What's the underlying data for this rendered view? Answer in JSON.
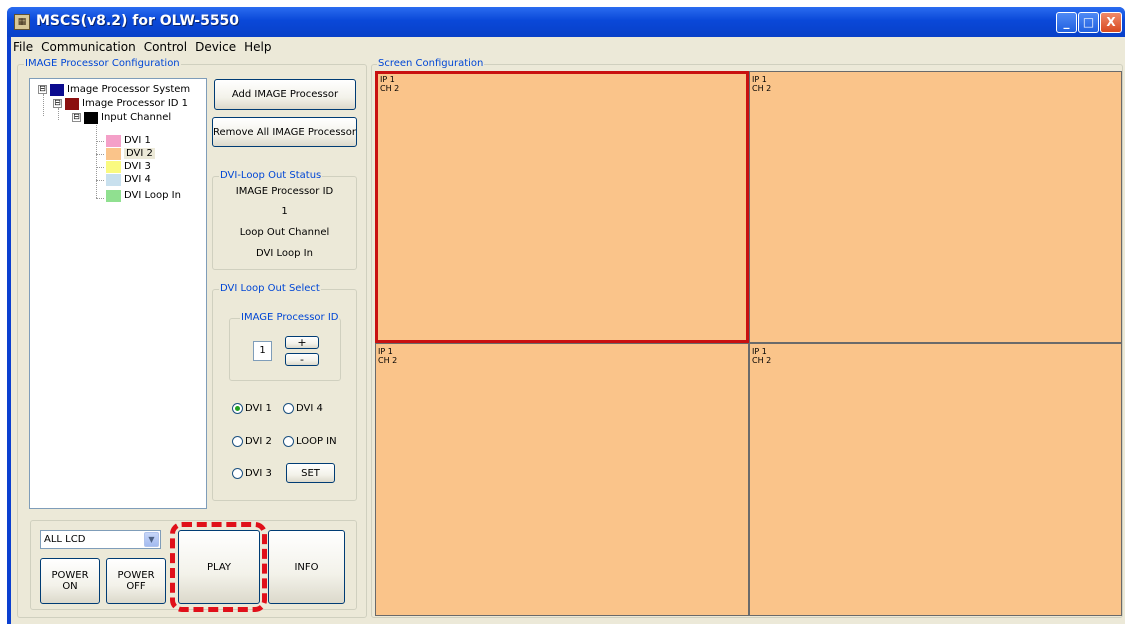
{
  "window": {
    "title": "MSCS(v8.2) for OLW-5550",
    "app_icon_text": "▦",
    "minimize_symbol": "_",
    "maximize_symbol": "□",
    "close_symbol": "X"
  },
  "menu": [
    "File",
    "Communication",
    "Control",
    "Device",
    "Help"
  ],
  "image_processor_config": {
    "legend": "IMAGE  Processor  Configuration",
    "tree": [
      {
        "label": "Image Processor System",
        "color": "#0b0b8f",
        "expander": "⊟"
      },
      {
        "label": "Image Processor ID 1",
        "color": "#8b0f0f",
        "expander": "⊟"
      },
      {
        "label": "Input Channel",
        "color": "#000000",
        "expander": "⊟"
      },
      {
        "label": "DVI 1",
        "color": "#f4a0c8"
      },
      {
        "label": "DVI 2",
        "color": "#fac48a",
        "selected": true
      },
      {
        "label": "DVI 3",
        "color": "#fafa80"
      },
      {
        "label": "DVI 4",
        "color": "#c8e0ee"
      },
      {
        "label": "DVI Loop In",
        "color": "#90e090"
      }
    ],
    "add_button": "Add IMAGE Processor",
    "remove_button": "Remove All IMAGE Processor",
    "loop_out_status": {
      "legend": "DVI-Loop Out Status",
      "id_label": "IMAGE Processor ID",
      "id_value": "1",
      "channel_label": "Loop Out Channel",
      "channel_value": "DVI Loop In"
    },
    "loop_out_select": {
      "legend": "DVI Loop Out Select",
      "id_legend": "IMAGE Processor ID",
      "id_value": "1",
      "plus": "+",
      "minus": "-",
      "radios": [
        {
          "label": "DVI 1",
          "checked": true
        },
        {
          "label": "DVI 4",
          "checked": false
        },
        {
          "label": "DVI 2",
          "checked": false
        },
        {
          "label": "LOOP IN",
          "checked": false
        },
        {
          "label": "DVI 3",
          "checked": false
        }
      ],
      "set_button": "SET"
    }
  },
  "bottom_controls": {
    "select_value": "ALL LCD",
    "select_arrow": "▼",
    "power_on_line1": "POWER",
    "power_on_line2": "ON",
    "power_off_line1": "POWER",
    "power_off_line2": "OFF",
    "play": "PLAY",
    "info": "INFO",
    "highlight_color": "#e0101a"
  },
  "screen_config": {
    "legend": "Screen Configuration",
    "tile_color": "#fac48a",
    "selected_border": "#c81010",
    "tiles": [
      {
        "line1": "IP 1",
        "line2": "CH 2",
        "selected": true
      },
      {
        "line1": "IP 1",
        "line2": "CH 2",
        "selected": false
      },
      {
        "line1": "IP 1",
        "line2": "CH 2",
        "selected": false
      },
      {
        "line1": "IP 1",
        "line2": "CH 2",
        "selected": false
      }
    ]
  }
}
